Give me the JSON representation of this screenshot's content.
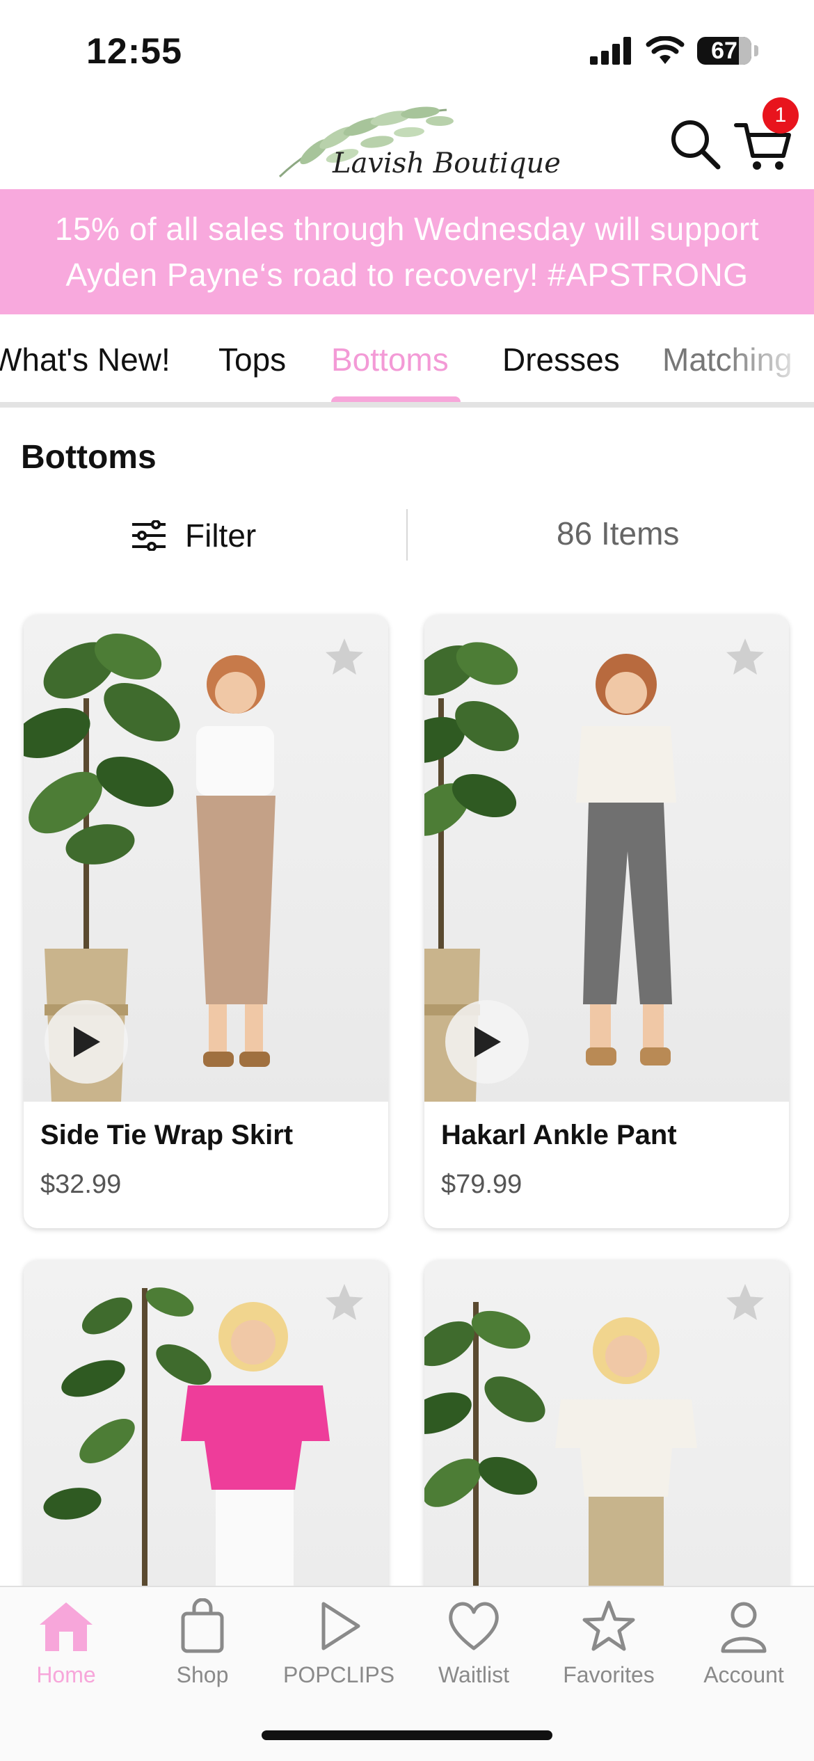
{
  "status_bar": {
    "time": "12:55",
    "battery": "67"
  },
  "header": {
    "logo_text": "Lavish Boutique",
    "cart_count": "1",
    "search_icon": "search-icon",
    "cart_icon": "cart-icon"
  },
  "promo": {
    "text": "15% of all sales through Wednesday will support Ayden Payne‘s road to recovery! #APSTRONG"
  },
  "tabs": {
    "items": [
      "What's New!",
      "Tops",
      "Bottoms",
      "Dresses",
      "Matching"
    ],
    "active": "Bottoms"
  },
  "page": {
    "title": "Bottoms",
    "filter_label": "Filter",
    "item_count": "86 Items"
  },
  "products": [
    {
      "name": "Side Tie Wrap Skirt",
      "price": "$32.99"
    },
    {
      "name": "Hakarl Ankle Pant",
      "price": "$79.99"
    },
    {
      "name": "",
      "price": ""
    },
    {
      "name": "",
      "price": ""
    }
  ],
  "bottom_nav": {
    "items": [
      "Home",
      "Shop",
      "POPCLIPS",
      "Waitlist",
      "Favorites",
      "Account"
    ],
    "active": "Home"
  },
  "colors": {
    "accent_pink": "#f7a6da",
    "banner_pink": "#f8a9dd",
    "badge_red": "#e8141d"
  }
}
